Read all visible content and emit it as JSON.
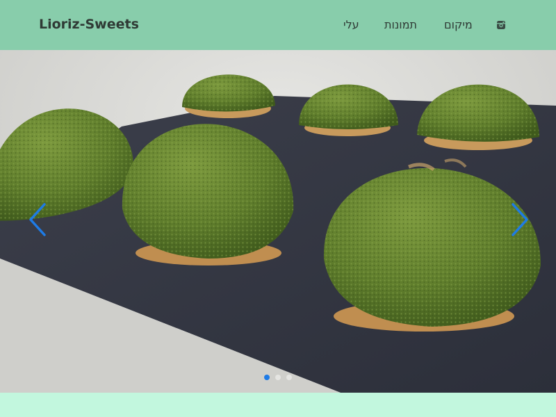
{
  "site": {
    "brand": "Lioriz-Sweets"
  },
  "nav": {
    "items": [
      {
        "label": "עלי"
      },
      {
        "label": "תמונות"
      },
      {
        "label": "מיקום"
      }
    ],
    "instagram_icon": "instagram-icon"
  },
  "carousel": {
    "slide_count": 3,
    "active_index": 0,
    "image_subject": "green pistachio choux pastries on slate board",
    "prev_icon": "chevron-left-icon",
    "next_icon": "chevron-right-icon"
  },
  "colors": {
    "navbar": "#88cdab",
    "page_background": "#c2f7de",
    "accent": "#1e7be6",
    "brand_text": "#2f3a35"
  }
}
